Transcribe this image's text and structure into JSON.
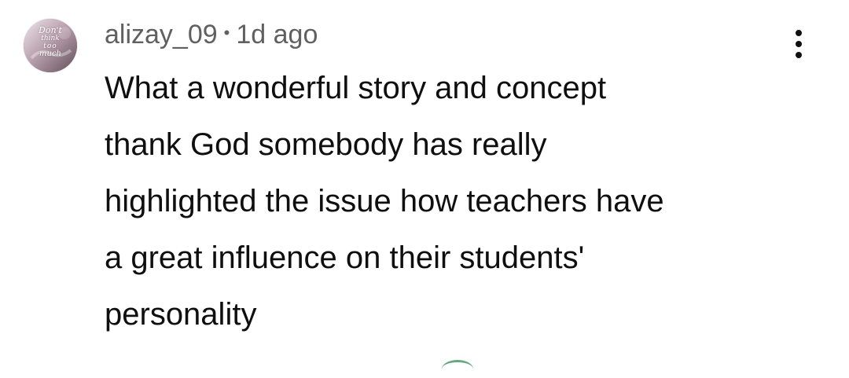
{
  "comment": {
    "author": "alizay_09",
    "separator": "•",
    "time": "1d ago",
    "avatar_text": [
      "Don't",
      "think",
      "too",
      "much"
    ],
    "lines": [
      "What a wonderful story and concept",
      "thank God somebody has really",
      "highlighted the issue how teachers have",
      "a great influence on their students'",
      "personality"
    ]
  },
  "icons": {
    "menu": "more-vertical-icon"
  },
  "colors": {
    "text_primary": "#0f0f0f",
    "text_secondary": "#606060",
    "background": "#ffffff"
  }
}
